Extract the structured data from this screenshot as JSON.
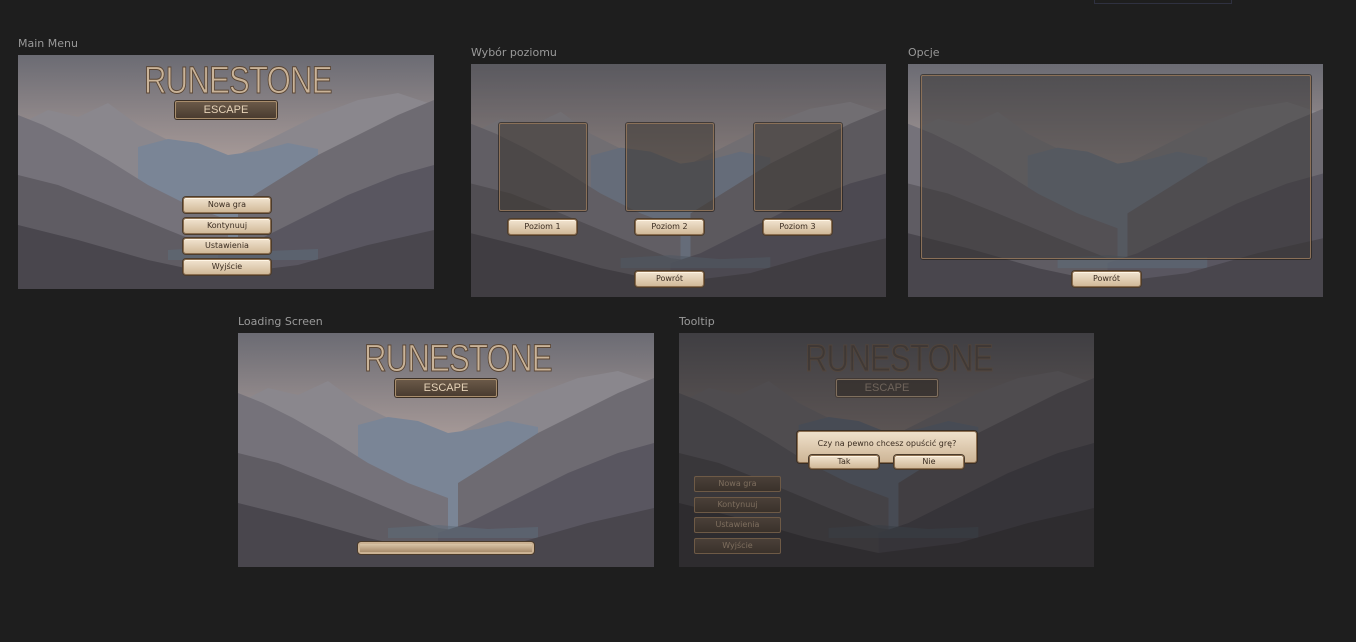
{
  "frames": {
    "main_menu": {
      "label": "Main Menu",
      "logo_title": "RUNESTONE",
      "logo_sub": "ESCAPE",
      "buttons": [
        "Nowa gra",
        "Kontynuuj",
        "Ustawienia",
        "Wyjście"
      ]
    },
    "level_select": {
      "label": "Wybór poziomu",
      "levels": [
        "Poziom 1",
        "Poziom 2",
        "Poziom 3"
      ],
      "back": "Powrót"
    },
    "options": {
      "label": "Opcje",
      "back": "Powrót"
    },
    "loading": {
      "label": "Loading Screen",
      "logo_title": "RUNESTONE",
      "logo_sub": "ESCAPE",
      "progress": 1.0
    },
    "tooltip": {
      "label": "Tooltip",
      "logo_title": "RUNESTONE",
      "logo_sub": "ESCAPE",
      "question": "Czy na pewno chcesz opuścić grę?",
      "yes": "Tak",
      "no": "Nie",
      "buttons": [
        "Nowa gra",
        "Kontynuuj",
        "Ustawienia",
        "Wyjście"
      ]
    }
  },
  "colors": {
    "canvas": "#1e1e1e",
    "button": "#e2cfb5",
    "button_border": "#8c6f50",
    "logo": "#c9b398"
  }
}
